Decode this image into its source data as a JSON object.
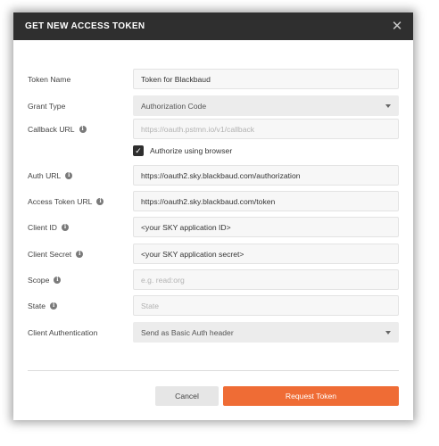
{
  "dialog": {
    "title": "GET NEW ACCESS TOKEN",
    "close_glyph": "✕"
  },
  "fields": {
    "token_name": {
      "label": "Token Name",
      "value": "Token for Blackbaud"
    },
    "grant_type": {
      "label": "Grant Type",
      "value": "Authorization Code"
    },
    "callback_url": {
      "label": "Callback URL",
      "placeholder": "https://oauth.pstmn.io/v1/callback"
    },
    "authorize_browser": {
      "label": "Authorize using browser",
      "checked": true,
      "glyph": "✓"
    },
    "auth_url": {
      "label": "Auth URL",
      "value": "https://oauth2.sky.blackbaud.com/authorization"
    },
    "access_token_url": {
      "label": "Access Token URL",
      "value": "https://oauth2.sky.blackbaud.com/token"
    },
    "client_id": {
      "label": "Client ID",
      "value": "<your SKY application ID>"
    },
    "client_secret": {
      "label": "Client Secret",
      "value": "<your SKY application secret>"
    },
    "scope": {
      "label": "Scope",
      "placeholder": "e.g. read:org"
    },
    "state": {
      "label": "State",
      "placeholder": "State"
    },
    "client_authentication": {
      "label": "Client Authentication",
      "value": "Send as Basic Auth header"
    }
  },
  "info_glyph": "i",
  "buttons": {
    "cancel": "Cancel",
    "request_token": "Request Token"
  },
  "colors": {
    "titlebar": "#2f2f2f",
    "primary": "#ef6c35"
  },
  "icons": [
    "close-icon",
    "info-icon",
    "chevron-down-icon",
    "checkmark-icon"
  ]
}
